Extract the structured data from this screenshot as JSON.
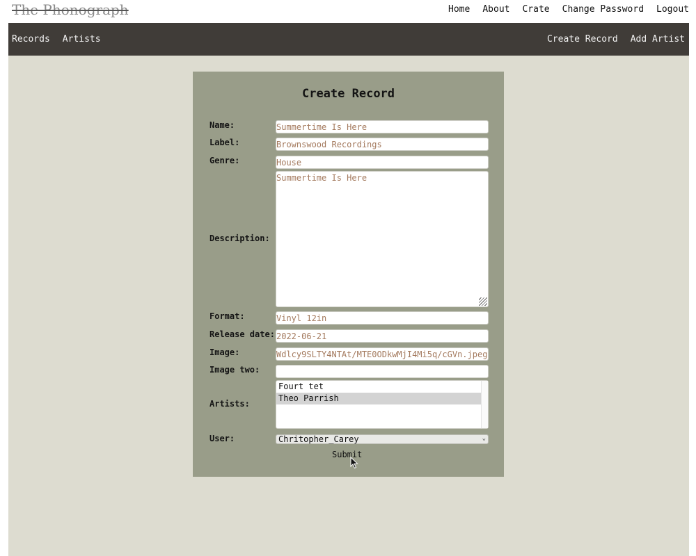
{
  "header": {
    "logo": "The Phonograph",
    "nav": [
      "Home",
      "About",
      "Crate",
      "Change Password",
      "Logout"
    ]
  },
  "mainnav": {
    "left": [
      "Records",
      "Artists"
    ],
    "right": [
      "Create Record",
      "Add Artist"
    ]
  },
  "form": {
    "title": "Create Record",
    "labels": {
      "name": "Name:",
      "label": "Label:",
      "genre": "Genre:",
      "description": "Description:",
      "format": "Format:",
      "release_date": "Release date:",
      "image": "Image:",
      "image_two": "Image two:",
      "artists": "Artists:",
      "user": "User:"
    },
    "values": {
      "name": "Summertime Is Here",
      "label": "Brownswood Recordings",
      "genre": "House",
      "description": "Summertime Is Here",
      "format": "Vinyl 12in",
      "release_date": "2022-06-21",
      "image": "Wdlcy9SLTY4NTAt/MTE0ODkwMjI4Mi5q/cGVn.jpeg",
      "image_two": ""
    },
    "artists_options": [
      "Fourt tet",
      "Theo Parrish"
    ],
    "artists_selected": "Theo Parrish",
    "user_selected": "Chritopher_Carey",
    "submit_label": "Submit"
  },
  "colors": {
    "nav_bg": "#403c38",
    "page_bg": "#dddcd0",
    "card_bg": "#999d89",
    "field_text": "#a47a5e"
  }
}
